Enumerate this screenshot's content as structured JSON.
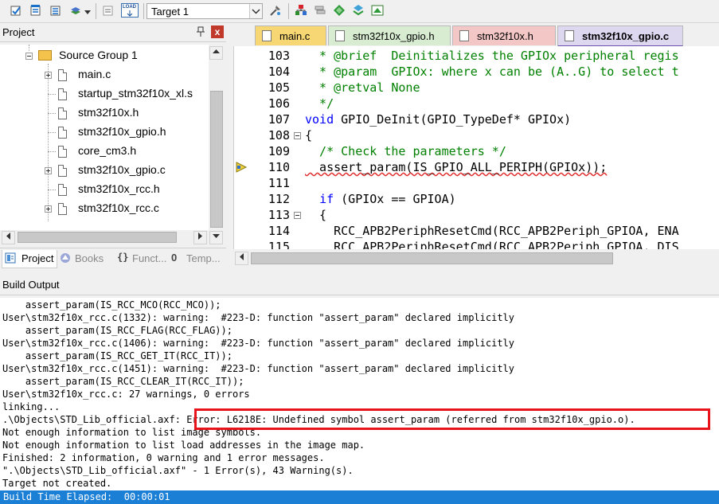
{
  "toolbar": {
    "target_label": "Target 1",
    "icons": [
      "translate-icon",
      "build-icon",
      "rebuild-icon",
      "batch-build-icon",
      "dropdown-icon",
      "download-icon",
      "target-options-icon",
      "manage-project-icon",
      "manage-books-icon",
      "manage-components-icon",
      "select-packs-icon",
      "pack-installer-icon"
    ],
    "download_icon_text": "LOAD"
  },
  "project_panel": {
    "title": "Project",
    "close_glyph": "x",
    "group": "Source Group 1",
    "files": [
      {
        "name": "main.c",
        "expandable": true
      },
      {
        "name": "startup_stm32f10x_xl.s",
        "expandable": false
      },
      {
        "name": "stm32f10x.h",
        "expandable": false
      },
      {
        "name": "stm32f10x_gpio.h",
        "expandable": false
      },
      {
        "name": "core_cm3.h",
        "expandable": false
      },
      {
        "name": "stm32f10x_gpio.c",
        "expandable": true
      },
      {
        "name": "stm32f10x_rcc.h",
        "expandable": false
      },
      {
        "name": "stm32f10x_rcc.c",
        "expandable": true
      }
    ],
    "tabs": [
      {
        "label": "Project",
        "active": true
      },
      {
        "label": "Books",
        "active": false
      },
      {
        "label": "Funct...",
        "active": false
      },
      {
        "label": "Temp...",
        "active": false
      }
    ],
    "tab_icon_glyphs": {
      "functions": "{}",
      "templates": "0"
    }
  },
  "editor": {
    "tabs": [
      {
        "label": "main.c",
        "color": "#f7d774",
        "active": false
      },
      {
        "label": "stm32f10x_gpio.h",
        "color": "#d8ecd2",
        "active": false
      },
      {
        "label": "stm32f10x.h",
        "color": "#f4c7c7",
        "active": false
      },
      {
        "label": "stm32f10x_gpio.c",
        "color": "#ddd8f0",
        "active": true
      }
    ],
    "lines": [
      {
        "n": "103",
        "fold": false,
        "parts": [
          {
            "t": "  * @brief  Deinitializes the GPIOx peripheral regis",
            "c": "comment"
          }
        ]
      },
      {
        "n": "104",
        "fold": false,
        "parts": [
          {
            "t": "  * @param  GPIOx: where x can be (A..G) to select t",
            "c": "comment"
          }
        ]
      },
      {
        "n": "105",
        "fold": false,
        "parts": [
          {
            "t": "  * @retval None",
            "c": "comment"
          }
        ]
      },
      {
        "n": "106",
        "fold": false,
        "parts": [
          {
            "t": "  */",
            "c": "comment"
          }
        ]
      },
      {
        "n": "107",
        "fold": false,
        "parts": [
          {
            "t": "void",
            "c": "kw"
          },
          {
            "t": " GPIO_DeInit(GPIO_TypeDef* GPIOx)",
            "c": "plain"
          }
        ]
      },
      {
        "n": "108",
        "fold": true,
        "parts": [
          {
            "t": "{",
            "c": "plain"
          }
        ]
      },
      {
        "n": "109",
        "fold": false,
        "parts": [
          {
            "t": "  /* Check the parameters */",
            "c": "comment"
          }
        ]
      },
      {
        "n": "110",
        "fold": false,
        "marker": true,
        "parts": [
          {
            "t": "  assert_param(IS_GPIO_ALL_PERIPH(GPIOx));",
            "c": "plain"
          }
        ]
      },
      {
        "n": "111",
        "fold": false,
        "parts": [
          {
            "t": "",
            "c": "plain"
          }
        ]
      },
      {
        "n": "112",
        "fold": false,
        "parts": [
          {
            "t": "  ",
            "c": "plain"
          },
          {
            "t": "if",
            "c": "kw"
          },
          {
            "t": " (GPIOx == GPIOA)",
            "c": "plain"
          }
        ]
      },
      {
        "n": "113",
        "fold": true,
        "parts": [
          {
            "t": "  {",
            "c": "plain"
          }
        ]
      },
      {
        "n": "114",
        "fold": false,
        "parts": [
          {
            "t": "    RCC_APB2PeriphResetCmd(RCC_APB2Periph_GPIOA, ENA",
            "c": "plain"
          }
        ]
      },
      {
        "n": "115",
        "fold": false,
        "parts": [
          {
            "t": "    RCC_APB2PeriphResetCmd(RCC_APB2Periph_GPIOA, DIS",
            "c": "plain"
          }
        ]
      }
    ]
  },
  "build_output": {
    "title": "Build Output",
    "lines": [
      "    assert_param(IS_RCC_MCO(RCC_MCO));",
      "User\\stm32f10x_rcc.c(1332): warning:  #223-D: function \"assert_param\" declared implicitly",
      "    assert_param(IS_RCC_FLAG(RCC_FLAG));",
      "User\\stm32f10x_rcc.c(1406): warning:  #223-D: function \"assert_param\" declared implicitly",
      "    assert_param(IS_RCC_GET_IT(RCC_IT));",
      "User\\stm32f10x_rcc.c(1451): warning:  #223-D: function \"assert_param\" declared implicitly",
      "    assert_param(IS_RCC_CLEAR_IT(RCC_IT));",
      "User\\stm32f10x_rcc.c: 27 warnings, 0 errors",
      "linking...",
      ".\\Objects\\STD_Lib_official.axf: Error: L6218E: Undefined symbol assert_param (referred from stm32f10x_gpio.o).",
      "Not enough information to list image symbols.",
      "Not enough information to list load addresses in the image map.",
      "Finished: 2 information, 0 warning and 1 error messages.",
      "\".\\Objects\\STD_Lib_official.axf\" - 1 Error(s), 43 Warning(s).",
      "Target not created."
    ],
    "status": "Build Time Elapsed:  00:00:01"
  }
}
